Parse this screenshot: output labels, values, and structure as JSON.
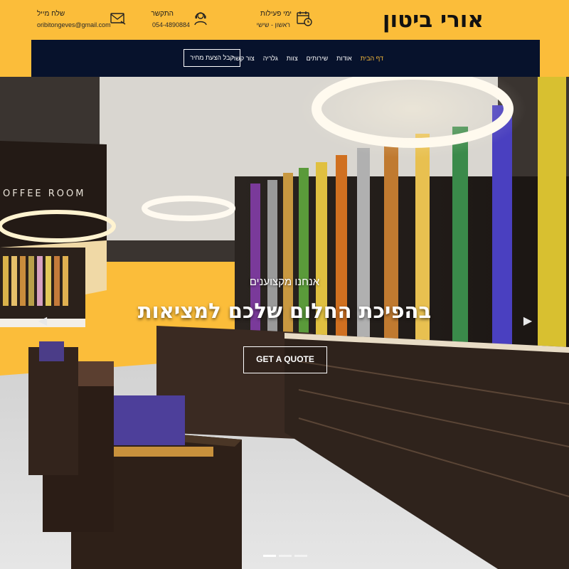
{
  "header": {
    "brand": "אורי ביטון",
    "hours": {
      "label": "ימי פעילות",
      "value": "ראשון - שישי"
    },
    "phone": {
      "label": "התקשר",
      "value": "054-4890884"
    },
    "email": {
      "label": "שלח מייל",
      "value": "oribitongeves@gmail.com"
    }
  },
  "nav": {
    "items": [
      {
        "label": "דף הבית"
      },
      {
        "label": "אודות"
      },
      {
        "label": "שירותים"
      },
      {
        "label": "צוות"
      },
      {
        "label": "גלריה"
      },
      {
        "label": "צור קשר"
      }
    ],
    "cta": "קבל הצעת מחיר"
  },
  "hero": {
    "subtitle": "אנחנו מקצוענים",
    "title": "בהפיכת החלום שלכם למציאות",
    "button": "GET A QUOTE",
    "slides": 3,
    "active_slide": 1
  },
  "colors": {
    "accent": "#fbbd3a",
    "nav_bg": "#07122c"
  }
}
